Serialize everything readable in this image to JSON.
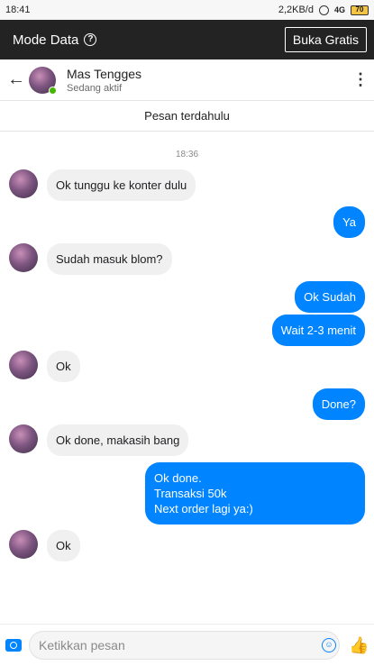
{
  "status_bar": {
    "time": "18:41",
    "network_speed": "2,2KB/d",
    "signal": "4G",
    "battery": "70"
  },
  "data_bar": {
    "label": "Mode Data",
    "button": "Buka Gratis"
  },
  "header": {
    "contact_name": "Mas Tengges",
    "status": "Sedang aktif"
  },
  "older_messages": "Pesan terdahulu",
  "timestamp": "18:36",
  "messages": [
    {
      "side": "in",
      "text": "Ok tunggu ke konter dulu"
    },
    {
      "side": "out",
      "text": "Ya"
    },
    {
      "side": "in",
      "text": "Sudah masuk blom?"
    },
    {
      "side": "out",
      "text": "Ok Sudah"
    },
    {
      "side": "out",
      "text": "Wait 2-3 menit"
    },
    {
      "side": "in",
      "text": "Ok"
    },
    {
      "side": "out",
      "text": "Done?"
    },
    {
      "side": "in",
      "text": "Ok done, makasih bang"
    },
    {
      "side": "out",
      "text": "Ok done.\nTransaksi 50k\nNext order lagi ya:)"
    },
    {
      "side": "in",
      "text": "Ok"
    }
  ],
  "composer": {
    "placeholder": "Ketikkan pesan"
  },
  "icons": {
    "back": "arrow-left-icon",
    "more": "more-vertical-icon",
    "camera": "camera-icon",
    "emoji": "emoji-icon",
    "like": "thumbs-up-icon"
  },
  "colors": {
    "accent": "#0084ff",
    "incoming_bubble": "#f1f0f0",
    "active": "#44b700",
    "data_bar": "#232323"
  }
}
